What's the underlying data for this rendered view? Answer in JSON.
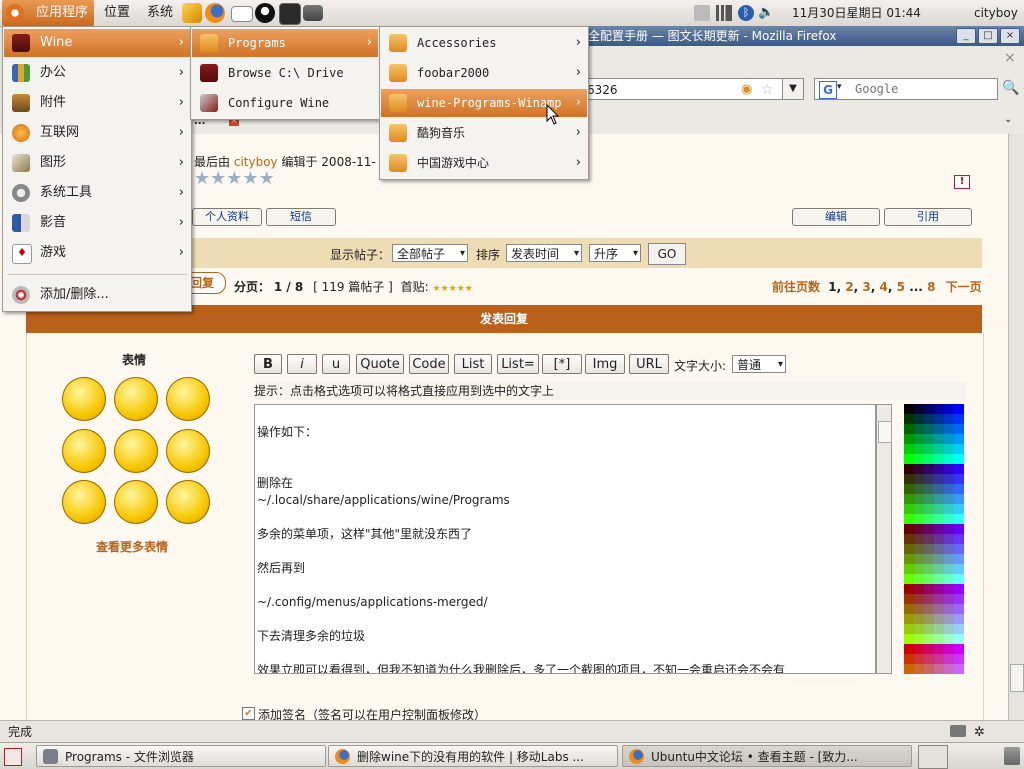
{
  "top_panel": {
    "menus": [
      "应用程序",
      "位置",
      "系统"
    ],
    "clock": "11月30日星期日 01:44",
    "user": "cityboy"
  },
  "firefox": {
    "title": "全配置手册 — 图文长期更新 - Mozilla Firefox",
    "url_fragment": "6326",
    "search_placeholder": "Google",
    "tab_label": "...",
    "status": "完成"
  },
  "post": {
    "edited_prefix": "最后由",
    "edited_user": "cityboy",
    "edited_suffix": "编辑于 2008-11-",
    "profile_btn": "个人资料",
    "pm_btn": "短信",
    "edit_btn": "编辑",
    "quote_btn": "引用"
  },
  "view_bar": {
    "show_label": "显示帖子：",
    "show_value": "全部帖子",
    "sort_label": "排序",
    "sort_value": "发表时间",
    "order_value": "升序",
    "go": "GO"
  },
  "pagination": {
    "reply_btn": "回复",
    "page_label": "分页：",
    "page_value": "1 / 8",
    "posts_info": "[ 119 篇帖子 ]",
    "first_post": "首贴:",
    "goto_label": "前往页数",
    "pages": [
      "1",
      "2",
      "3",
      "4",
      "5",
      "...",
      "8"
    ],
    "next": "下一页"
  },
  "reply": {
    "header": "发表回复",
    "smilies_title": "表情",
    "more_smilies": "查看更多表情",
    "format_buttons": [
      "B",
      "i",
      "u",
      "Quote",
      "Code",
      "List",
      "List=",
      "[*]",
      "Img",
      "URL"
    ],
    "font_size_label": "文字大小:",
    "font_size_value": "普通",
    "hint": "提示：点击格式选项可以将格式直接应用到选中的文字上",
    "editor_lines": [
      "",
      "操作如下：",
      "",
      "",
      "删除在",
      "~/.local/share/applications/wine/Programs",
      "",
      "多余的菜单项，这样\"其他\"里就没东西了",
      "",
      "然后再到",
      "",
      "~/.config/menus/applications-merged/",
      "",
      "下去清理多余的垃圾",
      "",
      "效果立即可以看得到，但我不知道为什么我删除后，多了一个截图的项目，不知一会重启还会不会有"
    ],
    "signature_label": "添加签名（签名可以在用户控制面板修改）"
  },
  "apps_menu": {
    "items": [
      "Wine",
      "办公",
      "附件",
      "互联网",
      "图形",
      "系统工具",
      "影音",
      "游戏"
    ],
    "footer": "添加/删除..."
  },
  "wine_menu": {
    "items": [
      "Programs",
      "Browse C:\\ Drive",
      "Configure Wine"
    ]
  },
  "programs_menu": {
    "items": [
      "Accessories",
      "foobar2000",
      "wine-Programs-Winamp",
      "酷狗音乐",
      "中国游戏中心"
    ]
  },
  "taskbar": {
    "items": [
      "Programs - 文件浏览器",
      "删除wine下的没有用的软件 | 移动Labs ...",
      "Ubuntu中文论坛 • 查看主题 - [致力..."
    ]
  },
  "colors": {
    "menu_highlight": "#d8803a",
    "reply_header": "#b9611a",
    "view_bar": "#eedcb4",
    "link": "#b5651d"
  }
}
